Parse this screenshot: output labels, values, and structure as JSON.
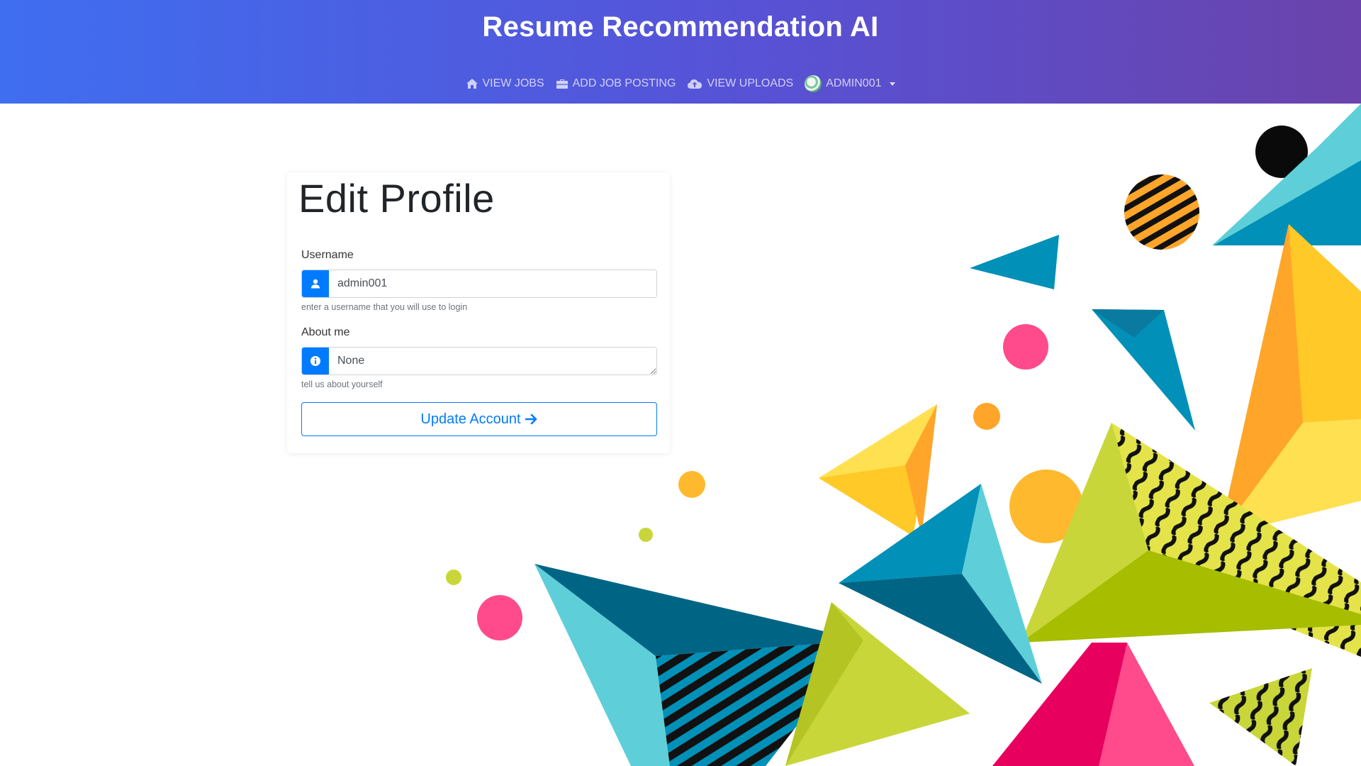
{
  "app": {
    "title": "Resume Recommendation AI"
  },
  "nav": {
    "items": [
      {
        "label": "VIEW JOBS",
        "icon": "home-icon"
      },
      {
        "label": "ADD JOB POSTING",
        "icon": "briefcase-icon"
      },
      {
        "label": "VIEW UPLOADS",
        "icon": "cloud-upload-icon"
      }
    ],
    "user": {
      "label": "ADMIN001",
      "icon": "avatar"
    }
  },
  "form": {
    "title": "Edit Profile",
    "username": {
      "label": "Username",
      "value": "admin001",
      "help": "enter a username that you will use to login",
      "icon": "user-icon"
    },
    "about": {
      "label": "About me",
      "value": "None",
      "help": "tell us about yourself",
      "icon": "info-icon"
    },
    "submit": {
      "label": "Update Account",
      "icon": "arrow-right-icon"
    }
  },
  "colors": {
    "header_gradient_start": "#3f6ef0",
    "header_gradient_end": "#6a43ab",
    "primary": "#007bff",
    "art_teal": "#0090b8",
    "art_cyan": "#5ecfd9",
    "art_yellow": "#ffc928",
    "art_orange": "#ffa52a",
    "art_pink": "#ff4b8b",
    "art_lime": "#c8d63a",
    "art_dark_teal": "#006585"
  }
}
